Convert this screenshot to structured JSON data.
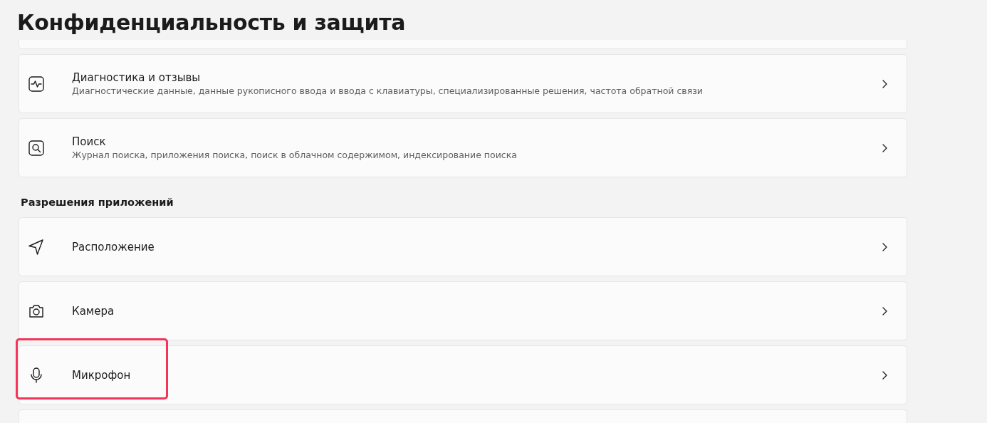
{
  "page_title": "Конфиденциальность и защита",
  "groups": [
    {
      "items": [
        {
          "title": "Диагностика и отзывы",
          "description": "Диагностические данные, данные рукописного ввода и ввода с клавиатуры, специализированные решения, частота обратной связи",
          "highlighted": false
        },
        {
          "title": "Поиск",
          "description": "Журнал поиска, приложения поиска, поиск в облачном содержимом, индексирование поиска",
          "highlighted": false
        }
      ]
    },
    {
      "heading": "Разрешения приложений",
      "items": [
        {
          "title": "Расположение",
          "highlighted": false
        },
        {
          "title": "Камера",
          "highlighted": false
        },
        {
          "title": "Микрофон",
          "highlighted": true
        }
      ]
    }
  ]
}
